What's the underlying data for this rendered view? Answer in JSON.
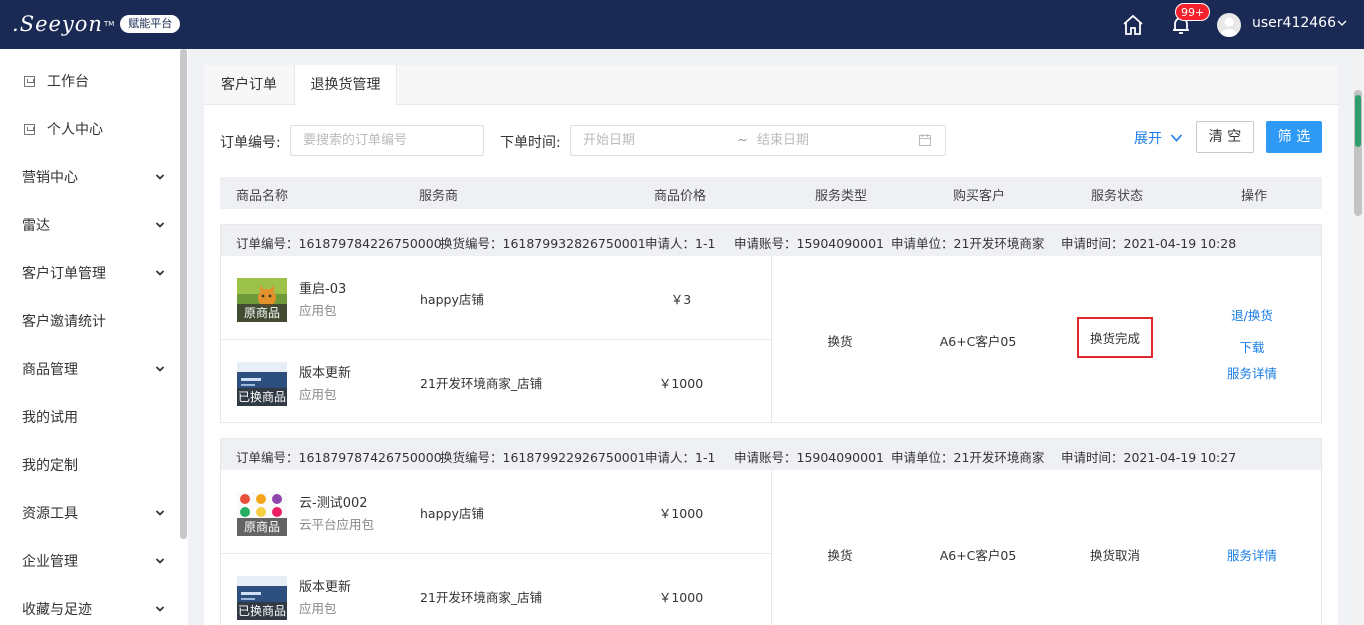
{
  "header": {
    "logo_text": "Seeyon",
    "logo_tm": "TM",
    "platform": "赋能平台",
    "notifications": "99+",
    "username": "user412466"
  },
  "sidebar": {
    "items": [
      {
        "label": "工作台",
        "icon": "page-icon",
        "has_children": false
      },
      {
        "label": "个人中心",
        "icon": "page-icon",
        "has_children": false
      },
      {
        "label": "营销中心",
        "has_children": true
      },
      {
        "label": "雷达",
        "has_children": true
      },
      {
        "label": "客户订单管理",
        "has_children": true
      },
      {
        "label": "客户邀请统计",
        "has_children": false
      },
      {
        "label": "商品管理",
        "has_children": true
      },
      {
        "label": "我的试用",
        "has_children": false
      },
      {
        "label": "我的定制",
        "has_children": false
      },
      {
        "label": "资源工具",
        "has_children": true
      },
      {
        "label": "企业管理",
        "has_children": true
      },
      {
        "label": "收藏与足迹",
        "has_children": true
      }
    ]
  },
  "tabs": [
    {
      "label": "客户订单",
      "active": false
    },
    {
      "label": "退换货管理",
      "active": true
    }
  ],
  "filters": {
    "order_no_label": "订单编号:",
    "order_no_placeholder": "要搜索的订单编号",
    "time_label": "下单时间:",
    "start_placeholder": "开始日期",
    "range_sep": "~",
    "end_placeholder": "结束日期",
    "expand": "展开",
    "clear": "清 空",
    "filter": "筛 选"
  },
  "table": {
    "columns": [
      "商品名称",
      "服务商",
      "商品价格",
      "服务类型",
      "购买客户",
      "服务状态",
      "操作"
    ],
    "orders": [
      {
        "order_no": "订单编号：161879784226750000",
        "exchange_no": "换货编号：161879932826750001",
        "applicant": "申请人：1-1",
        "account": "申请账号：15904090001",
        "unit": "申请单位：21开发环境商家",
        "time": "申请时间：2021-04-19 10:28",
        "products": [
          {
            "name": "重启-03",
            "type": "应用包",
            "vendor": "happy店铺",
            "price": "￥3",
            "tag": "原商品"
          },
          {
            "name": "版本更新",
            "type": "应用包",
            "vendor": "21开发环境商家_店铺",
            "price": "￥1000",
            "tag": "已换商品"
          }
        ],
        "service_type": "换货",
        "customer": "A6+C客户05",
        "status": "换货完成",
        "actions": [
          "退/换货",
          "下载",
          "服务详情"
        ]
      },
      {
        "order_no": "订单编号：161879787426750000",
        "exchange_no": "换货编号：161879922926750001",
        "applicant": "申请人：1-1",
        "account": "申请账号：15904090001",
        "unit": "申请单位：21开发环境商家",
        "time": "申请时间：2021-04-19 10:27",
        "products": [
          {
            "name": "云-测试002",
            "type": "云平台应用包",
            "vendor": "happy店铺",
            "price": "￥1000",
            "tag": "原商品"
          },
          {
            "name": "版本更新",
            "type": "应用包",
            "vendor": "21开发环境商家_店铺",
            "price": "￥1000",
            "tag": "已换商品"
          }
        ],
        "service_type": "换货",
        "customer": "A6+C客户05",
        "status": "换货取消",
        "actions": [
          "服务详情"
        ]
      }
    ]
  }
}
